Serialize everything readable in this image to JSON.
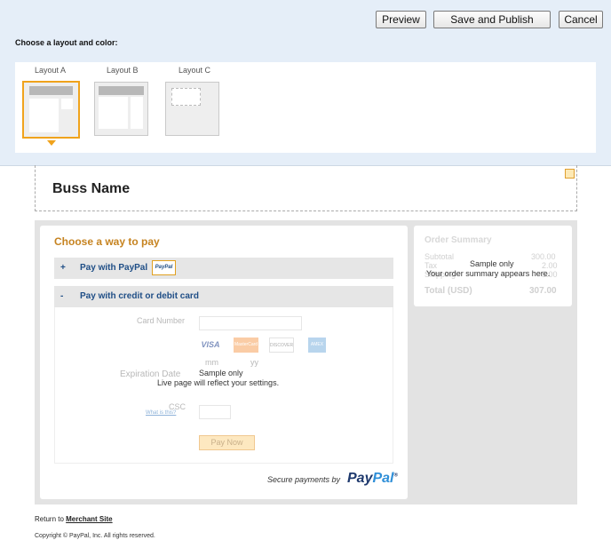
{
  "toolbar": {
    "preview_label": "Preview",
    "save_publish_label": "Save and Publish",
    "cancel_label": "Cancel"
  },
  "layout_chooser": {
    "label": "Choose a layout and color:",
    "options": [
      {
        "label": "Layout A",
        "selected": true
      },
      {
        "label": "Layout B",
        "selected": false
      },
      {
        "label": "Layout C",
        "selected": false
      }
    ],
    "accent_color": "#f0a31c"
  },
  "header": {
    "business_name": "Buss Name",
    "edit_icon": "edit-pencil-icon"
  },
  "payment": {
    "title": "Choose a way to pay",
    "paypal_option": {
      "sign": "+",
      "label": "Pay with PayPal",
      "badge": "PayPal"
    },
    "card_option": {
      "sign": "-",
      "label": "Pay with credit or debit card"
    },
    "card_number_label": "Card Number",
    "card_logos": [
      "VISA",
      "MasterCard",
      "DISCOVER",
      "AMEX"
    ],
    "expiration_label": "Expiration Date",
    "exp_month_placeholder": "mm",
    "exp_year_placeholder": "yy",
    "csc_label": "CSC",
    "csc_help": "What is this?",
    "pay_now_label": "Pay Now",
    "sample_only": "Sample only",
    "sample_note": "Live page will reflect your settings.",
    "secure_text": "Secure payments by",
    "paypal_logo": {
      "part1": "Pay",
      "part2": "Pal",
      "suffix": "®"
    }
  },
  "order_summary": {
    "title": "Order Summary",
    "rows": [
      {
        "label": "Subtotal",
        "value": "300.00"
      },
      {
        "label": "Tax",
        "value": "2.00"
      },
      {
        "label": "Shipping",
        "value": "5.00"
      }
    ],
    "total_label": "Total (USD)",
    "total_value": "307.00",
    "sample_only": "Sample only",
    "sample_note": "Your order summary appears here."
  },
  "footer": {
    "return_prefix": "Return to",
    "return_link": "Merchant Site",
    "copyright": "Copyright © PayPal, Inc. All rights reserved."
  }
}
